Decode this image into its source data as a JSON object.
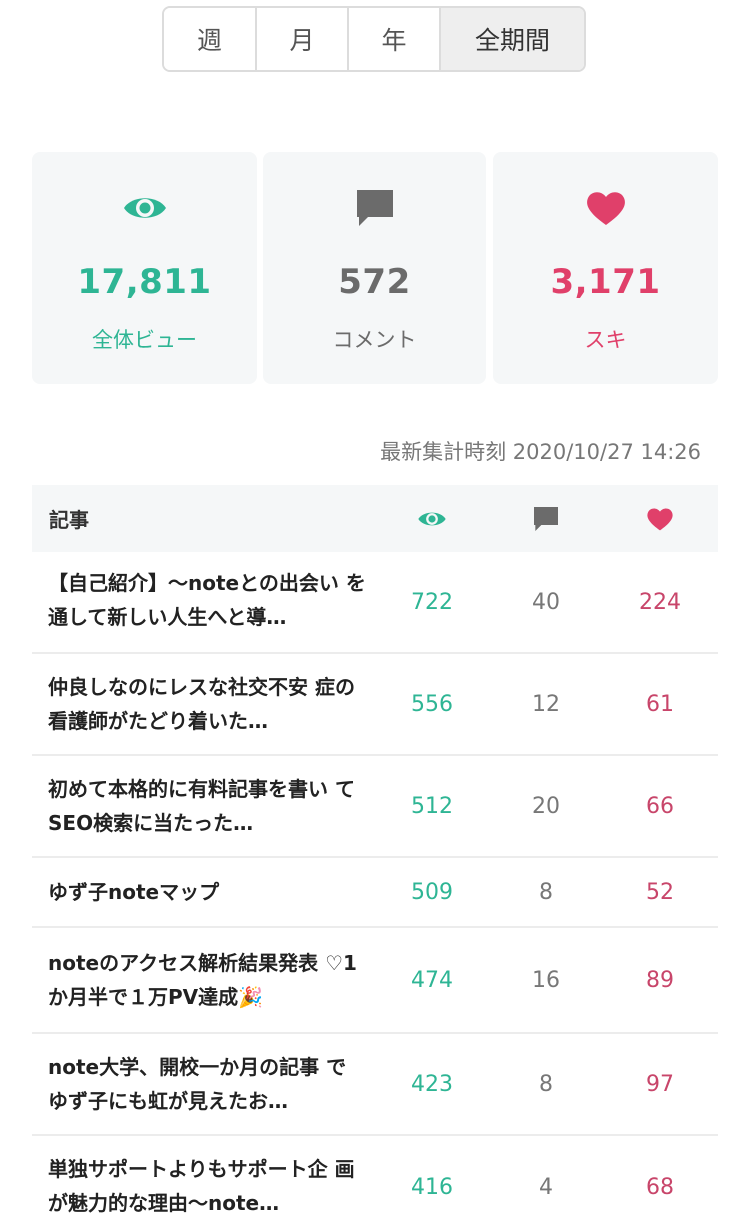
{
  "period_tabs": [
    {
      "label": "週",
      "active": false
    },
    {
      "label": "月",
      "active": false
    },
    {
      "label": "年",
      "active": false
    },
    {
      "label": "全期間",
      "active": true
    }
  ],
  "summary": {
    "views": {
      "value": "17,811",
      "label": "全体ビュー",
      "icon": "eye-icon"
    },
    "comments": {
      "value": "572",
      "label": "コメント",
      "icon": "comment-icon"
    },
    "likes": {
      "value": "3,171",
      "label": "スキ",
      "icon": "heart-icon"
    }
  },
  "updated_at": "最新集計時刻 2020/10/27 14:26",
  "table": {
    "header_title": "記事",
    "rows": [
      {
        "title": "【自己紹介】〜noteとの出会い を通して新しい人生へと導…",
        "views": "722",
        "comments": "40",
        "likes": "224"
      },
      {
        "title": "仲良しなのにレスな社交不安 症の看護師がたどり着いた…",
        "views": "556",
        "comments": "12",
        "likes": "61"
      },
      {
        "title": "初めて本格的に有料記事を書い て　SEO検索に当たった…",
        "views": "512",
        "comments": "20",
        "likes": "66"
      },
      {
        "title": "ゆず子noteマップ",
        "views": "509",
        "comments": "8",
        "likes": "52"
      },
      {
        "title": "noteのアクセス解析結果発表 ♡1か月半で１万PV達成🎉",
        "views": "474",
        "comments": "16",
        "likes": "89"
      },
      {
        "title": "note大学、開校一か月の記事 でゆず子にも虹が見えたお…",
        "views": "423",
        "comments": "8",
        "likes": "97"
      },
      {
        "title": "単独サポートよりもサポート企 画が魅力的な理由〜note…",
        "views": "416",
        "comments": "4",
        "likes": "68"
      }
    ]
  },
  "colors": {
    "teal": "#2eb594",
    "gray": "#6b6b6b",
    "pink": "#e0406a"
  }
}
